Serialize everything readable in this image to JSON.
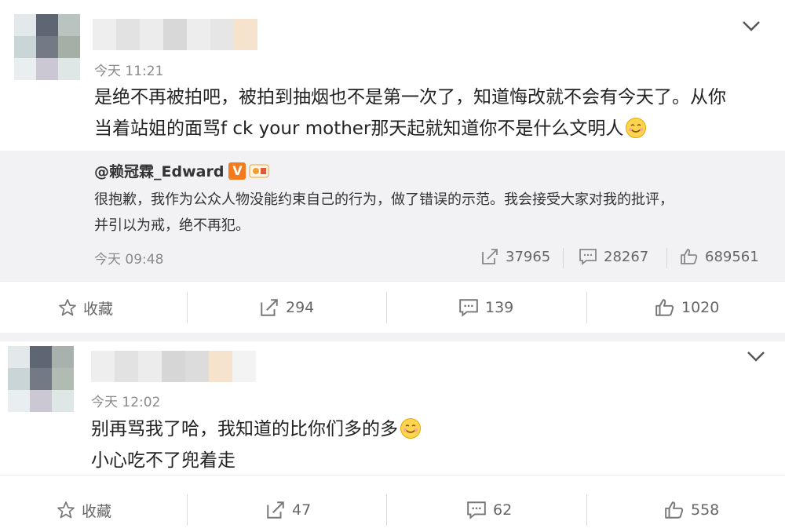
{
  "post1": {
    "time": "今天 11:21",
    "body_lines": [
      "是绝不再被拍吧，被拍到抽烟也不是第一次了，知道悔改就不会有今天了。从你",
      "当着站姐的面骂f ck your mother那天起就知道你不是什么文明人"
    ],
    "repost": {
      "author": "@赖冠霖_Edward",
      "verified_badge": "V",
      "text_lines": [
        "很抱歉，我作为公众人物没能约束自己的行为，做了错误的示范。我会接受大家对我的批评，",
        "并引以为戒，绝不再犯。"
      ],
      "time": "今天 09:48",
      "reposts": "37965",
      "comments": "28267",
      "likes": "689561"
    },
    "actions": {
      "favorite": "收藏",
      "reposts": "294",
      "comments": "139",
      "likes": "1020"
    }
  },
  "post2": {
    "time": "今天 12:02",
    "body_lines": [
      "别再骂我了哈，我知道的比你们多的多",
      "小心吃不了兜着走"
    ],
    "actions": {
      "favorite": "收藏",
      "reposts": "47",
      "comments": "62",
      "likes": "558"
    }
  },
  "icons": [
    "chevron-down-icon",
    "star-icon",
    "repost-icon",
    "comment-icon",
    "like-icon",
    "smile-emoji-icon"
  ],
  "colors": {
    "verified_badge": "#f37b1d",
    "repost_bg": "#f2f2f5",
    "meta_text": "#8a8a8a"
  }
}
